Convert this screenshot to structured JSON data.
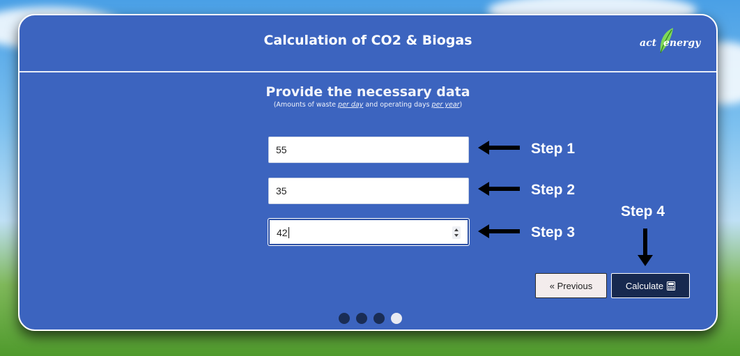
{
  "header": {
    "title": "Calculation of CO2 & Biogas",
    "logo_word_1": "act",
    "logo_word_2": "energy",
    "logo_icon": "leaf-icon"
  },
  "form": {
    "heading": "Provide the necessary data",
    "subheading_prefix": "(Amounts of waste ",
    "subheading_per_day": "per day",
    "subheading_middle": " and operating days ",
    "subheading_per_year": "per year",
    "subheading_suffix": ")",
    "fields": [
      {
        "value": "55"
      },
      {
        "value": "35"
      },
      {
        "value": "42",
        "focused": true,
        "type": "number"
      }
    ]
  },
  "annotations": {
    "step1": "Step 1",
    "step2": "Step 2",
    "step3": "Step 3",
    "step4": "Step 4"
  },
  "buttons": {
    "previous": "« Previous",
    "calculate": "Calculate",
    "calculate_icon": "calculator-icon"
  },
  "pagination": {
    "total": 4,
    "active_index": 4
  },
  "colors": {
    "card_background": "#3c64bf",
    "calculate_button": "#17294f",
    "dot_inactive": "#1a2d55",
    "dot_active": "#e8eaf2"
  }
}
